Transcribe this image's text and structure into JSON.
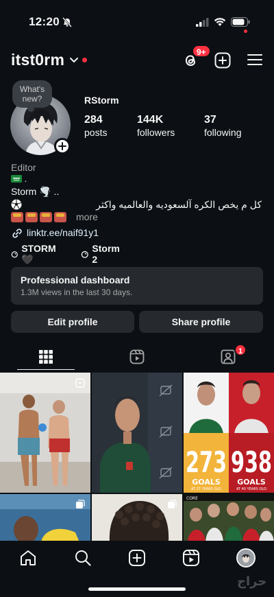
{
  "status_bar": {
    "time": "12:20"
  },
  "header": {
    "username": "itst0rm",
    "threads_badge": "9+"
  },
  "profile": {
    "note": "What's new?",
    "display_name": "RStorm",
    "stats": [
      {
        "value": "284",
        "label": "posts"
      },
      {
        "value": "144K",
        "label": "followers"
      },
      {
        "value": "37",
        "label": "following"
      }
    ],
    "category": "Editor",
    "flag_line": ".",
    "bio_line1": "Storm 🌪️ ..",
    "bio_line2": "كل م يخص الكره آلسعوديه والعالميه واكثر",
    "more": "more",
    "link": "linktr.ee/naif91y1",
    "threads_chips": [
      "STORM 🖤",
      "Storm 2"
    ]
  },
  "dashboard": {
    "title": "Professional dashboard",
    "subtitle": "1.3M views in the last 30 days."
  },
  "buttons": {
    "edit": "Edit profile",
    "share": "Share profile"
  },
  "tabs": {
    "tagged_badge": "1"
  },
  "grid": {
    "posts": [
      {
        "kind": "video"
      },
      {
        "kind": "image"
      },
      {
        "kind": "image",
        "big_number_1": "273",
        "big_number_2": "938",
        "goals_1": "GOALS",
        "goals_2": "GOALS",
        "age_1": "AT 27 YEARS OLD",
        "age_2": "AT 40 YEARS OLD"
      },
      {
        "kind": "carousel"
      },
      {
        "kind": "carousel"
      },
      {
        "kind": "image",
        "caption": "CORE"
      }
    ]
  },
  "watermark": "حراج",
  "colors": {
    "background": "#0c1014",
    "surface": "#262a2f",
    "accent_red": "#ff3040",
    "link": "#e0f1ff",
    "muted": "#a8a8a8"
  }
}
